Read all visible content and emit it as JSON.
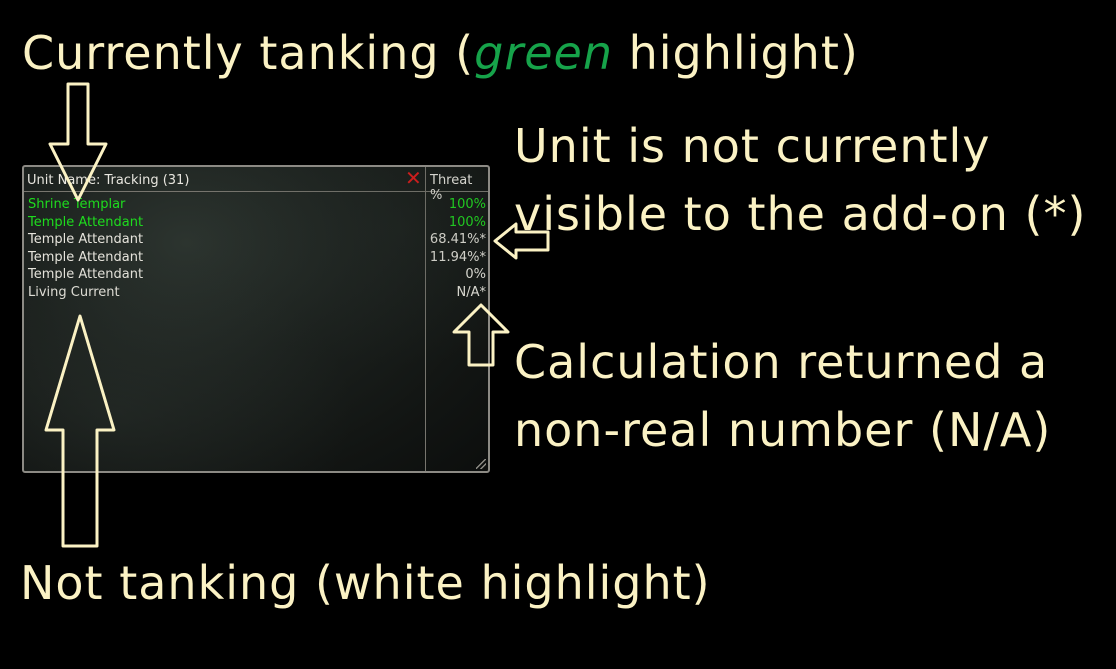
{
  "annotations": {
    "top_prefix": "Currently tanking (",
    "top_green": "green",
    "top_suffix": " highlight)",
    "right_top_line1": "Unit is not currently",
    "right_top_line2": "visible to the add-on (*)",
    "right_bottom_line1": "Calculation returned a",
    "right_bottom_line2": "non-real number (N/A)",
    "bottom": "Not tanking (white highlight)"
  },
  "window": {
    "unit_header": "Unit Name: Tracking (31)",
    "threat_header": "Threat %",
    "rows": [
      {
        "name": "Shrine Templar",
        "value": "100%",
        "status": "tanking"
      },
      {
        "name": "Temple Attendant",
        "value": "100%",
        "status": "tanking"
      },
      {
        "name": "Temple Attendant",
        "value": "68.41%*",
        "status": "not-tanking"
      },
      {
        "name": "Temple Attendant",
        "value": "11.94%*",
        "status": "not-tanking"
      },
      {
        "name": "Temple Attendant",
        "value": "0%",
        "status": "not-tanking"
      },
      {
        "name": "Living Current",
        "value": "N/A*",
        "status": "not-tanking"
      }
    ]
  },
  "colors": {
    "annotation_text": "#fbf2c4",
    "green_word": "#16a34a",
    "tanking_row": "#1edc1e",
    "not_tanking_row": "#e6e4dc",
    "close_icon": "#e01a1a",
    "background": "#000000"
  },
  "icons": {
    "close": "close-icon",
    "arrows": [
      "arrow-down-icon",
      "arrow-up-icon",
      "arrow-left-icon",
      "arrow-up-small-icon"
    ]
  }
}
